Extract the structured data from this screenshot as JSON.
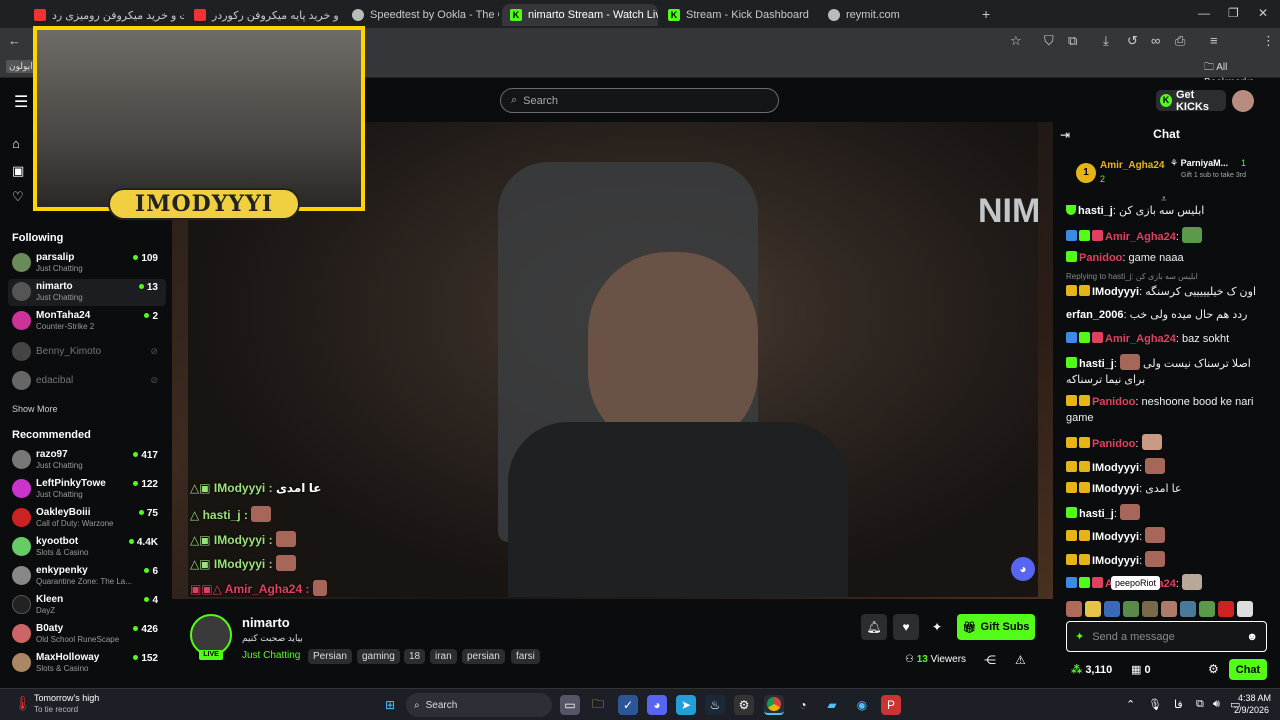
{
  "browser": {
    "tabs": [
      {
        "title": "قیمت و خرید میکروفن رومیزی رد",
        "color": "#e33"
      },
      {
        "title": "قیمت و خرید پایه میکروفن رکوردر",
        "color": "#e33"
      },
      {
        "title": "Speedtest by Ookla - The Glob",
        "color": "#bbb"
      },
      {
        "title": "nimarto Stream - Watch Liv",
        "color": "#53fc18"
      },
      {
        "title": "Stream - Kick Dashboard",
        "color": "#53fc18"
      },
      {
        "title": "reymit.com",
        "color": "#bbb"
      }
    ],
    "bookmarks_label": "All Bookmarks",
    "bookmark_left": "ایولون"
  },
  "kick": {
    "search_placeholder": "Search",
    "get_kicks": "Get KICKs"
  },
  "sidebar": {
    "following_label": "Following",
    "following": [
      {
        "name": "parsalip",
        "category": "Just Chatting",
        "viewers": "109",
        "color": "#6a8a5a"
      },
      {
        "name": "nimarto",
        "category": "Just Chatting",
        "viewers": "13",
        "color": "#555"
      },
      {
        "name": "MonTaha24",
        "category": "Counter-Strike 2",
        "viewers": "2",
        "color": "#c39"
      },
      {
        "name": "Benny_Kimoto",
        "category": "",
        "viewers": "",
        "color": "#444"
      },
      {
        "name": "edacibal",
        "category": "",
        "viewers": "",
        "color": "#666"
      }
    ],
    "show_more": "Show More",
    "recommended_label": "Recommended",
    "recommended": [
      {
        "name": "razo97",
        "category": "Just Chatting",
        "viewers": "417",
        "color": "#777"
      },
      {
        "name": "LeftPinkyTowe",
        "category": "Just Chatting",
        "viewers": "122",
        "color": "#c3c"
      },
      {
        "name": "OakleyBoiii",
        "category": "Call of Duty: Warzone",
        "viewers": "75",
        "color": "#c22"
      },
      {
        "name": "kyootbot",
        "category": "Slots & Casino",
        "viewers": "4.4K",
        "color": "#6c6"
      },
      {
        "name": "enkypenky",
        "category": "Quarantine Zone: The La...",
        "viewers": "6",
        "color": "#888"
      },
      {
        "name": "Kleen",
        "category": "DayZ",
        "viewers": "4",
        "color": "#222"
      },
      {
        "name": "B0aty",
        "category": "Old School RuneScape",
        "viewers": "426",
        "color": "#c66"
      },
      {
        "name": "MaxHolloway",
        "category": "Slots & Casino",
        "viewers": "152",
        "color": "#a86"
      }
    ]
  },
  "video": {
    "cam_label": "IMODYYYI",
    "overlay_chat": [
      {
        "user": "IModyyyi",
        "text": "عا امدی",
        "color": "#9be27a"
      },
      {
        "user": "hasti_j",
        "text": "",
        "color": "#9be27a"
      },
      {
        "user": "IModyyyi",
        "text": "",
        "color": "#9be27a"
      },
      {
        "user": "IModyyyi",
        "text": "",
        "color": "#9be27a"
      },
      {
        "user": "Amir_Agha24",
        "text": "",
        "color": "#e04060"
      }
    ]
  },
  "stream": {
    "channel": "nimarto",
    "title": "بیاید صحبت کنیم",
    "category": "Just Chatting",
    "live": "LIVE",
    "tags": [
      "Persian",
      "gaming",
      "18",
      "iran",
      "persian",
      "farsi"
    ],
    "viewers_count": "13",
    "viewers_label": "Viewers",
    "gift_subs": "Gift Subs"
  },
  "chat": {
    "title": "Chat",
    "leader1": {
      "name": "Amir_Agha24",
      "count": "2"
    },
    "leader2": {
      "name": "ParniyaM...",
      "count": "1",
      "note": "Gift 1 sub to take 3rd"
    },
    "messages": [
      {
        "user": "hasti_j",
        "text": "ابلیس سه بازی کن",
        "color": "#ffffff"
      },
      {
        "user": "Amir_Agha24",
        "text": "",
        "color": "#e04060"
      },
      {
        "user": "Panidoo",
        "text": "game naaa",
        "color": "#e04060"
      },
      {
        "reply": "Replying to hasti_j: ابلیس سه بازی کن"
      },
      {
        "user": "IModyyyi",
        "text": "اون ک خیلیییییی کرسنگه",
        "color": "#ffffff"
      },
      {
        "user": "erfan_2006",
        "text": "ردد هم حال میده ولی خب",
        "color": "#ffffff"
      },
      {
        "user": "Amir_Agha24",
        "text": "baz sokht",
        "color": "#e04060"
      },
      {
        "user": "hasti_j",
        "text": "اصلا ترسناک نیست ولی برای نیما ترسناکه",
        "color": "#ffffff"
      },
      {
        "user": "Panidoo",
        "text": "neshoone bood ke nari game",
        "color": "#e04060"
      },
      {
        "user": "Panidoo",
        "text": "",
        "color": "#e04060"
      },
      {
        "user": "IModyyyi",
        "text": "",
        "color": "#ffffff"
      },
      {
        "user": "IModyyyi",
        "text": "عا امدی",
        "color": "#ffffff"
      },
      {
        "user": "hasti_j",
        "text": "",
        "color": "#ffffff"
      },
      {
        "user": "IModyyyi",
        "text": "",
        "color": "#ffffff"
      },
      {
        "user": "IModyyyi",
        "text": "",
        "color": "#ffffff"
      },
      {
        "user": "Amir_Agha24",
        "text": "",
        "color": "#e04060"
      }
    ],
    "tooltip": "peepoRiot",
    "input_placeholder": "Send a message",
    "points": "3,110",
    "other_count": "0",
    "chat_button": "Chat"
  },
  "taskbar": {
    "weather_title": "Tomorrow's high",
    "weather_sub": "To tie record",
    "search": "Search",
    "time": "4:38 AM",
    "date": "2/9/2026",
    "lang": "فا"
  }
}
